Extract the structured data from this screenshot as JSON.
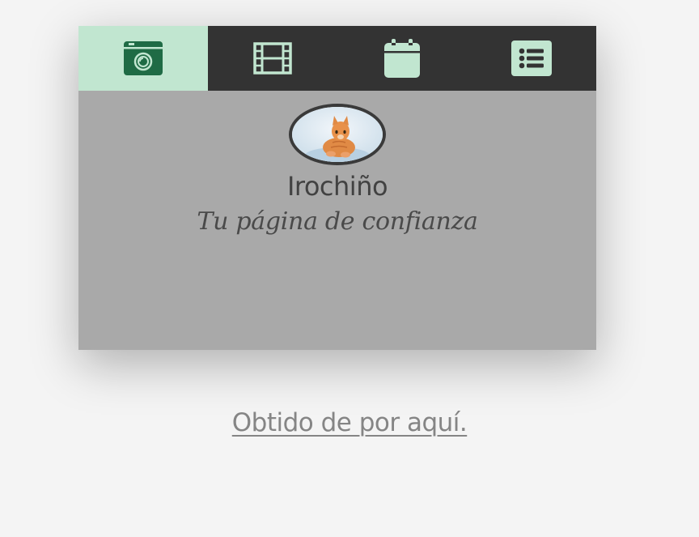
{
  "tabs": [
    {
      "icon": "camera-icon",
      "active": true
    },
    {
      "icon": "film-icon",
      "active": false
    },
    {
      "icon": "calendar-icon",
      "active": false
    },
    {
      "icon": "list-icon",
      "active": false
    }
  ],
  "profile": {
    "avatar_icon": "cat-avatar",
    "name": "Irochiño",
    "tagline": "Tu página de confianza"
  },
  "footer": {
    "link_text": "Obtido de por aquí."
  },
  "colors": {
    "tabbar_bg": "#333333",
    "active_tab_bg": "#c1e6d0",
    "icon_color": "#c1e6d0",
    "active_icon_color": "#1f6b45",
    "card_bg": "#a9a9a9",
    "page_bg": "#f4f4f4"
  }
}
